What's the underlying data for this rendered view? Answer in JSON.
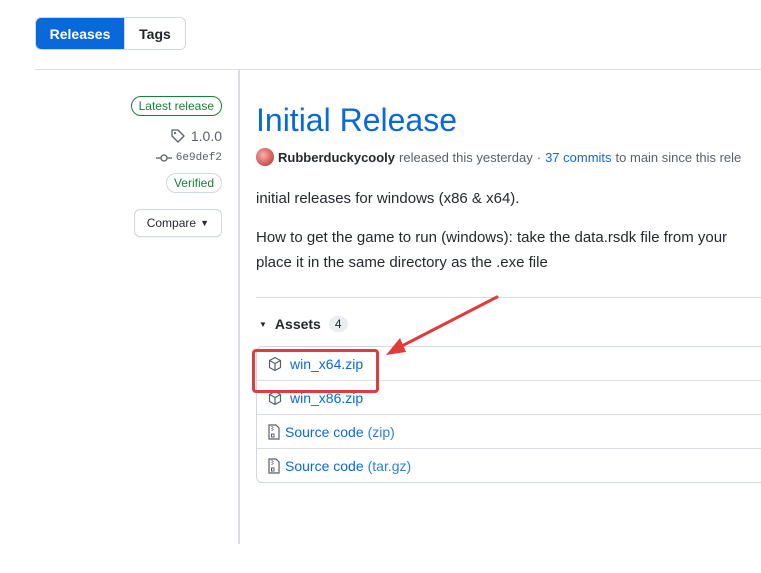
{
  "tabs": {
    "releases": "Releases",
    "tags": "Tags"
  },
  "sidebar": {
    "latest_badge": "Latest release",
    "tag": "1.0.0",
    "commit": "6e9def2",
    "verified": "Verified",
    "compare": "Compare"
  },
  "release": {
    "title": "Initial Release",
    "author": "Rubberduckycooly",
    "released_text": "released this yesterday",
    "separator": "·",
    "commits_link": "37 commits",
    "commits_suffix": "to main since this rele",
    "paragraph1": "initial releases for windows (x86 & x64).",
    "paragraph2_line1": "How to get the game to run (windows): take the data.rsdk file from your",
    "paragraph2_line2": "place it in the same directory as the .exe file"
  },
  "assets": {
    "label": "Assets",
    "count": "4",
    "items": [
      {
        "name": "win_x64.zip",
        "ext": "",
        "icon": "package-icon"
      },
      {
        "name": "win_x86.zip",
        "ext": "",
        "icon": "package-icon"
      },
      {
        "name": "Source code",
        "ext": "(zip)",
        "icon": "file-zip-icon"
      },
      {
        "name": "Source code",
        "ext": "(tar.gz)",
        "icon": "file-zip-icon"
      }
    ]
  },
  "annotation": {
    "color": "#e03c3c",
    "target": "win_x64.zip"
  },
  "colors": {
    "accent": "#0969da",
    "success": "#1a7f37"
  }
}
